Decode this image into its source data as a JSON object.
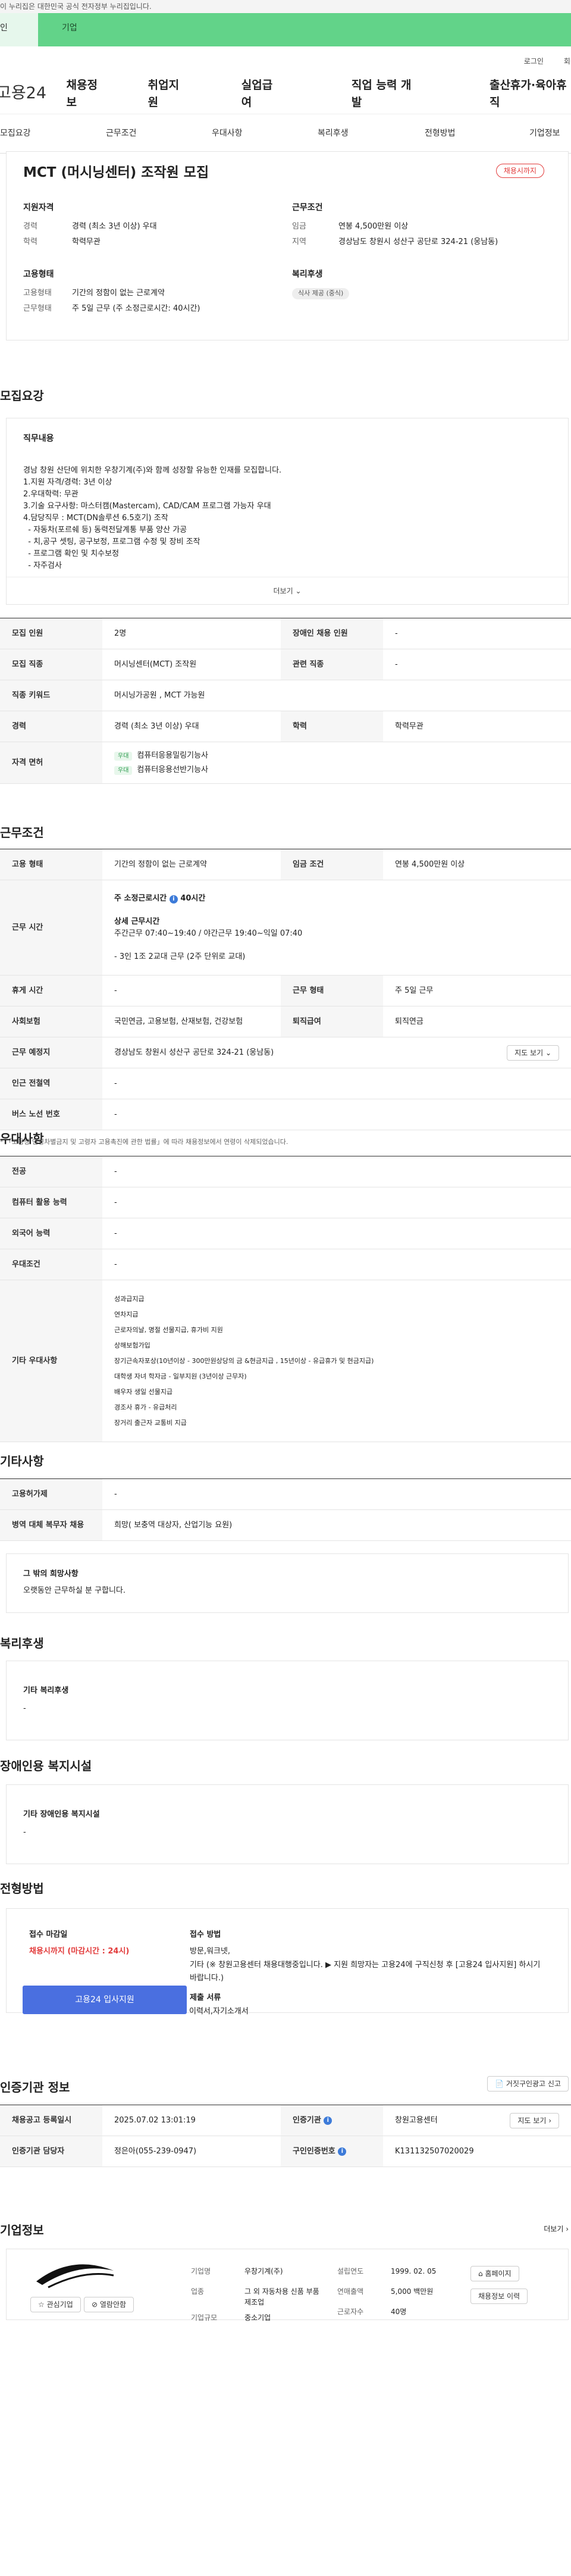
{
  "gov": "이 누리집은 대한민국 공식 전자정부 누리집입니다.",
  "banner": {
    "left": "인",
    "right": "기업"
  },
  "util": [
    "로그인",
    "회원"
  ],
  "logo": "고용24",
  "gnb": [
    "채용정보",
    "취업지원",
    "실업급여",
    "직업 능력 개발",
    "출산휴가·육아휴직"
  ],
  "tabs": [
    "모집요강",
    "근무조건",
    "우대사항",
    "복리후생",
    "전형방법",
    "기업정보"
  ],
  "header": {
    "title": "MCT (머시닝센터) 조작원 모집",
    "badge": "채용시까지",
    "qual_h": "지원자격",
    "career_k": "경력",
    "career_v": "경력 (최소 3년 이상) 우대",
    "edu_k": "학력",
    "edu_v": "학력무관",
    "cond_h": "근무조건",
    "wage_k": "임금",
    "wage_v": "연봉 4,500만원 이상",
    "area_k": "지역",
    "area_v": "경상남도 창원시 성산구 공단로 324-21 (웅남동)",
    "emp_h": "고용형태",
    "type_k": "고용형태",
    "type_v": "기간의 정함이 없는 근로계약",
    "shape_k": "근무형태",
    "shape_v": "주 5일 근무 (주 소정근로시간: 40시간)",
    "ben_h": "복리후생",
    "ben_tag": "식사 제공 (중식)"
  },
  "recruit": {
    "title": "모집요강",
    "duty_h": "직무내용",
    "duty": [
      "경남 창원 산단에 위치한 우창기계(주)와 함께 성장할 유능한 인재를 모집합니다.",
      "1.지원 자격/경력: 3년 이상",
      "2.우대학력: 무관",
      "3.기술 요구사항: 마스터캠(Mastercam), CAD/CAM 프로그램 가능자 우대",
      "4.담당직무 : MCT(DN솔루션 6.5호기) 조작",
      "  - 자동차(포르쉐 등) 동력전달계통 부품 양산 가공",
      "  - 치,공구 셋팅, 공구보정, 프로그램 수정 및 장비 조작",
      "  - 프로그램 확인 및 치수보정",
      "  - 자주검사"
    ],
    "more": "더보기",
    "rows": [
      [
        "모집 인원",
        "2명",
        "장애인 채용 인원",
        "-"
      ],
      [
        "모집 직종",
        "머시닝센터(MCT) 조작원",
        "관련 직종",
        "-"
      ],
      [
        "직종 키워드",
        "머시닝가공원 , MCT 가능원"
      ],
      [
        "경력",
        "경력 (최소 3년 이상) 우대",
        "학력",
        "학력무관"
      ]
    ],
    "license_k": "자격 면허",
    "licenses": [
      "컴퓨터응용밀링기능사",
      "컴퓨터응용선반기능사"
    ],
    "lic_tag": "우대"
  },
  "work": {
    "title": "근무조건",
    "r1": [
      "고용 형태",
      "기간의 정함이 없는 근로계약",
      "임금 조건",
      "연봉 4,500만원 이상"
    ],
    "hours_k": "근무 시간",
    "hours_total": "주 소정근로시간",
    "hours_num": "40시간",
    "detail_h": "상세 근무시간",
    "detail": "주간근무  07:40~19:40 / 야간근무  19:40~익일 07:40",
    "detail2": "- 3인 1조 2교대 근무 (2주 단위로 교대)",
    "r3": [
      "휴게 시간",
      "-",
      "근무 형태",
      "주 5일 근무"
    ],
    "r4": [
      "사회보험",
      "국민연금, 고용보험, 산재보험, 건강보험",
      "퇴직급여",
      "퇴직연금"
    ],
    "r5": [
      "근무 예정지",
      "경상남도 창원시 성산구 공단로 324-21 (웅남동)"
    ],
    "map": "지도 보기",
    "r6": [
      "인근 전철역",
      "-"
    ],
    "r7": [
      "버스 노선 번호",
      "-"
    ],
    "note": "「고용상 연령차별금지 및 고령자 고용촉진에 관한 법률」에 따라 채용정보에서 연령이 삭제되었습니다."
  },
  "pref": {
    "title": "우대사항",
    "rows": [
      [
        "전공",
        "-"
      ],
      [
        "컴퓨터 활용 능력",
        "-"
      ],
      [
        "외국어 능력",
        "-"
      ],
      [
        "우대조건",
        "-"
      ]
    ],
    "etc_k": "기타 우대사항",
    "etc": [
      "성과급지급",
      "연차지급",
      "근로자의날, 명절 선물지급, 휴가비 지원",
      "상해보험가입",
      "장기근속자포상(10년이상 - 300만원상당의 금 &현금지급 , 15년이상 - 유급휴가 및 현금지급)",
      "대학생 자녀 학자금 - 일부지원 (3년이상 근무자)",
      "배우자 생일 선물지급",
      "경조사 휴가 - 유급처리",
      "장거리 출근자 교통비 지급"
    ]
  },
  "other": {
    "title": "기타사항",
    "rows": [
      [
        "고용허가제",
        "-"
      ],
      [
        "병역 대체 복무자 채용",
        "희망( 보충역 대상자, 산업기능 요원)"
      ]
    ],
    "hope_h": "그 밖의 희망사항",
    "hope": "오랫동안 근무하실 분 구합니다."
  },
  "welfare": {
    "title": "복리후생",
    "h": "기타 복리후생",
    "v": "-"
  },
  "facility": {
    "title": "장애인용 복지시설",
    "h": "기타 장애인용 복지시설",
    "v": "-"
  },
  "process": {
    "title": "전형방법",
    "dl_h": "접수 마감일",
    "dl_v": "채용시까지 (마감시간 : 24시)",
    "apply": "고용24 입사지원",
    "method_h": "접수 방법",
    "method": "방문,워크넷,",
    "method2": "기타 (※ 창원고용센터 채용대행중입니다.      ▶ 지원 희망자는 고용24에 구직신청 후 [고용24 입사지원] 하시기 바랍니다.)",
    "docs_h": "제출 서류",
    "docs": "이력서,자기소개서"
  },
  "agency": {
    "title": "인증기관 정보",
    "btn": "거짓구인광고 신고",
    "r1": [
      "채용공고 등록일시",
      "2025.07.02 13:01:19",
      "인증기관",
      "창원고용센터"
    ],
    "r2": [
      "인증기관 담당자",
      "정은아(055-239-0947)",
      "구인인증번호",
      "K131132507020029"
    ],
    "map": "지도 보기"
  },
  "company": {
    "title": "기업정보",
    "more": "더보기",
    "rows": [
      [
        "기업명",
        "우창기계(주)",
        "설립연도",
        "1999. 02. 05"
      ],
      [
        "업종",
        "그 외 자동차용 신품 부품 제조업",
        "연매출액",
        "5,000 백만원"
      ],
      [
        "기업규모",
        "중소기업",
        "근로자수",
        "40명"
      ]
    ],
    "b1": "홈페이지",
    "b2": "채용정보 이력",
    "like": "관심기업",
    "send": "열람안함"
  }
}
